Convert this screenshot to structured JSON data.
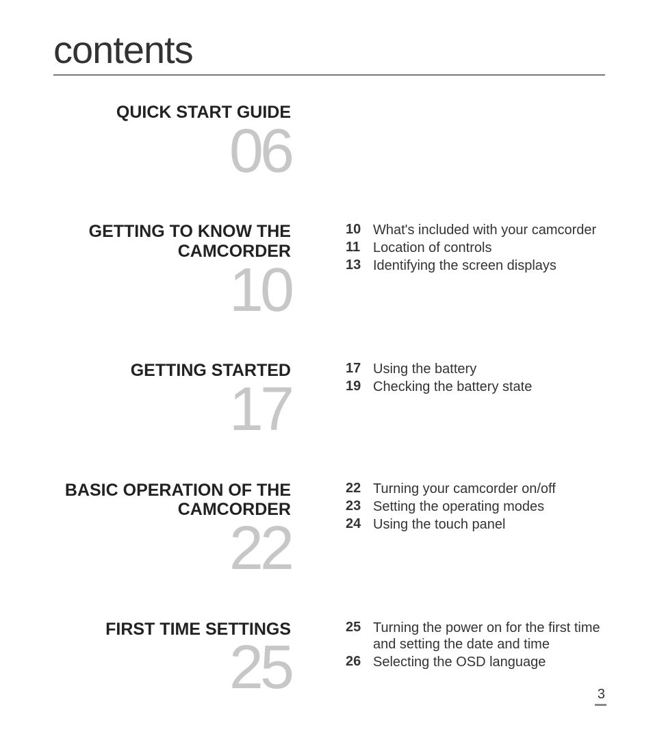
{
  "title": "contents",
  "page_number": "3",
  "sections": [
    {
      "heading_line1": "QUICK START GUIDE",
      "heading_line2": "",
      "page": "06",
      "subs": []
    },
    {
      "heading_line1": "GETTING TO KNOW THE",
      "heading_line2": "CAMCORDER",
      "page": "10",
      "subs": [
        {
          "p": "10",
          "t": "What's included with your camcorder"
        },
        {
          "p": "11",
          "t": "Location of controls"
        },
        {
          "p": "13",
          "t": "Identifying the screen displays"
        }
      ]
    },
    {
      "heading_line1": "GETTING STARTED",
      "heading_line2": "",
      "page": "17",
      "subs": [
        {
          "p": "17",
          "t": "Using the battery"
        },
        {
          "p": "19",
          "t": "Checking the battery state"
        }
      ]
    },
    {
      "heading_line1": "BASIC OPERATION OF THE",
      "heading_line2": "CAMCORDER",
      "page": "22",
      "subs": [
        {
          "p": "22",
          "t": "Turning your camcorder on/off"
        },
        {
          "p": "23",
          "t": "Setting the operating modes"
        },
        {
          "p": "24",
          "t": "Using the touch panel"
        }
      ]
    },
    {
      "heading_line1": "FIRST TIME SETTINGS",
      "heading_line2": "",
      "page": "25",
      "subs": [
        {
          "p": "25",
          "t": "Turning the power on for the first time and setting the date and time"
        },
        {
          "p": "26",
          "t": "Selecting the OSD language"
        }
      ]
    }
  ]
}
